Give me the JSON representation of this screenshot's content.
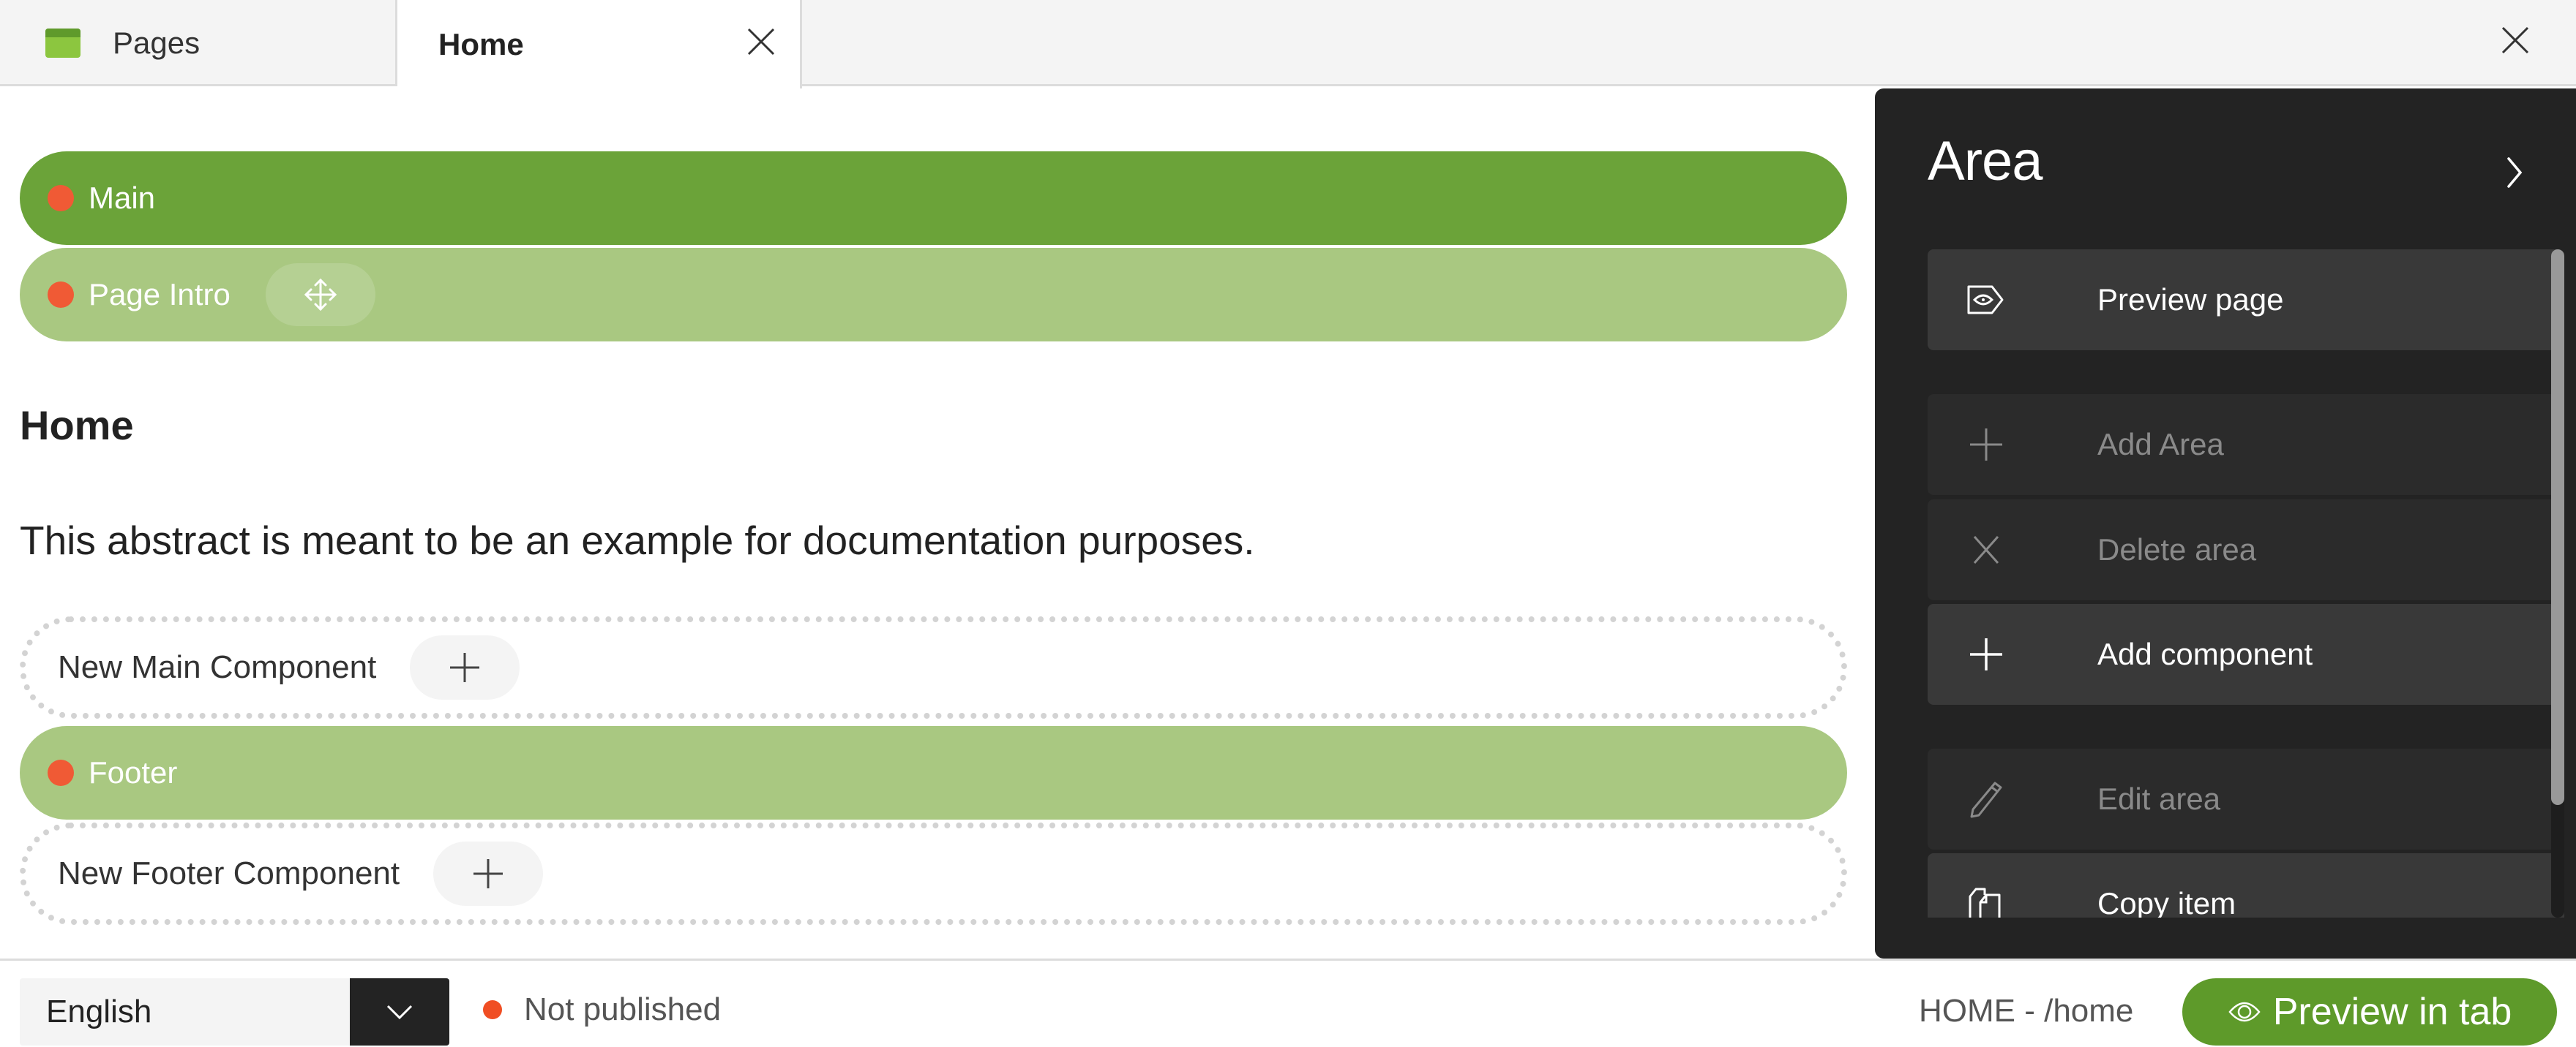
{
  "tabs": [
    {
      "label": "Pages",
      "icon": "pages-icon",
      "active": false
    },
    {
      "label": "Home",
      "active": true,
      "closable": true
    }
  ],
  "window": {
    "close_icon": "close-icon"
  },
  "canvas": {
    "areas": [
      {
        "label": "Main",
        "style": "dark",
        "status": "unpublished"
      },
      {
        "label": "Page Intro",
        "style": "light",
        "status": "unpublished",
        "move_icon": "move-icon"
      },
      {
        "label": "Footer",
        "style": "light",
        "status": "unpublished"
      }
    ],
    "heading": "Home",
    "abstract": "This abstract is meant to be an example for documentation purposes.",
    "dropzones": [
      {
        "label": "New Main Component",
        "add_icon": "plus-icon"
      },
      {
        "label": "New Footer Component",
        "add_icon": "plus-icon"
      }
    ]
  },
  "panel": {
    "title": "Area",
    "next_icon": "chevron-right-icon",
    "actions": [
      {
        "label": "Preview page",
        "icon": "preview-icon",
        "enabled": true
      },
      {
        "label": "Add Area",
        "icon": "plus-icon",
        "enabled": false
      },
      {
        "label": "Delete area",
        "icon": "x-icon",
        "enabled": false
      },
      {
        "label": "Add component",
        "icon": "plus-icon",
        "enabled": true
      },
      {
        "label": "Edit area",
        "icon": "pencil-icon",
        "enabled": false
      },
      {
        "label": "Copy item",
        "icon": "copy-icon",
        "enabled": true
      }
    ]
  },
  "bottom": {
    "language": {
      "value": "English"
    },
    "publish_status": "Not published",
    "page_path": "HOME - /home",
    "preview_button": "Preview in tab"
  },
  "colors": {
    "area_dark": "#6ba339",
    "area_light": "#a9c881",
    "status_dot": "#f05a35",
    "panel_bg": "#232323",
    "accent_button": "#5e9a2a"
  }
}
